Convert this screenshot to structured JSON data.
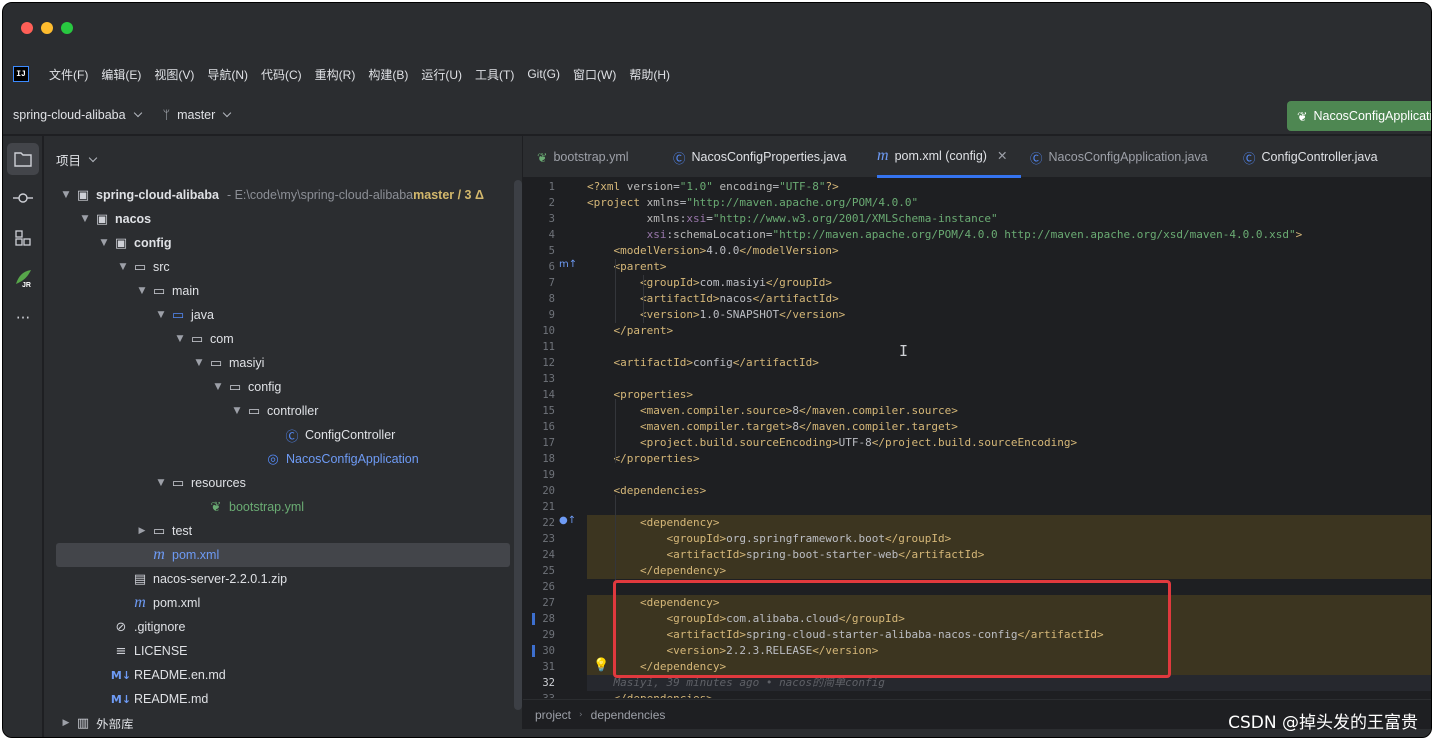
{
  "menu": {
    "logo": "IJ",
    "items": [
      "文件(F)",
      "编辑(E)",
      "视图(V)",
      "导航(N)",
      "代码(C)",
      "重构(R)",
      "构建(B)",
      "运行(U)",
      "工具(T)",
      "Git(G)",
      "窗口(W)",
      "帮助(H)"
    ]
  },
  "toolbar": {
    "project": "spring-cloud-alibaba",
    "branch": "master",
    "run_config": "NacosConfigApplication"
  },
  "project_panel": {
    "title": "项目",
    "root_path": "- E:\\code\\my\\spring-cloud-alibaba",
    "root_vcs": "master / 3 Δ",
    "tree": [
      {
        "label": "spring-cloud-alibaba",
        "depth": 0,
        "arrow": "v",
        "icon": "module-folder-icon",
        "style": "bold"
      },
      {
        "label": "nacos",
        "depth": 1,
        "arrow": "v",
        "icon": "module-folder-icon",
        "style": "bold"
      },
      {
        "label": "config",
        "depth": 2,
        "arrow": "v",
        "icon": "module-folder-icon",
        "style": "bold"
      },
      {
        "label": "src",
        "depth": 3,
        "arrow": "v",
        "icon": "folder-icon",
        "style": ""
      },
      {
        "label": "main",
        "depth": 4,
        "arrow": "v",
        "icon": "folder-icon",
        "style": ""
      },
      {
        "label": "java",
        "depth": 5,
        "arrow": "v",
        "icon": "source-folder-icon",
        "style": ""
      },
      {
        "label": "com",
        "depth": 6,
        "arrow": "v",
        "icon": "package-icon",
        "style": ""
      },
      {
        "label": "masiyi",
        "depth": 7,
        "arrow": "v",
        "icon": "package-icon",
        "style": ""
      },
      {
        "label": "config",
        "depth": 8,
        "arrow": "v",
        "icon": "package-icon",
        "style": ""
      },
      {
        "label": "controller",
        "depth": 9,
        "arrow": "v",
        "icon": "package-icon",
        "style": ""
      },
      {
        "label": "ConfigController",
        "depth": 11,
        "arrow": "",
        "icon": "java-class-icon",
        "style": ""
      },
      {
        "label": "NacosConfigApplication",
        "depth": 10,
        "arrow": "",
        "icon": "spring-app-icon",
        "style": "blue"
      },
      {
        "label": "resources",
        "depth": 5,
        "arrow": "v",
        "icon": "resources-folder-icon",
        "style": ""
      },
      {
        "label": "bootstrap.yml",
        "depth": 7,
        "arrow": "",
        "icon": "yaml-file-icon",
        "style": "green"
      },
      {
        "label": "test",
        "depth": 4,
        "arrow": ">",
        "icon": "folder-icon",
        "style": ""
      },
      {
        "label": "pom.xml",
        "depth": 4,
        "arrow": "",
        "icon": "maven-icon",
        "style": "blue"
      },
      {
        "label": "nacos-server-2.2.0.1.zip",
        "depth": 3,
        "arrow": "",
        "icon": "archive-icon",
        "style": ""
      },
      {
        "label": "pom.xml",
        "depth": 3,
        "arrow": "",
        "icon": "maven-icon",
        "style": ""
      },
      {
        "label": ".gitignore",
        "depth": 2,
        "arrow": "",
        "icon": "gitignore-icon",
        "style": ""
      },
      {
        "label": "LICENSE",
        "depth": 2,
        "arrow": "",
        "icon": "text-file-icon",
        "style": ""
      },
      {
        "label": "README.en.md",
        "depth": 2,
        "arrow": "",
        "icon": "markdown-icon",
        "style": ""
      },
      {
        "label": "README.md",
        "depth": 2,
        "arrow": "",
        "icon": "markdown-icon",
        "style": ""
      },
      {
        "label": "外部库",
        "depth": 0,
        "arrow": ">",
        "icon": "library-icon",
        "style": ""
      }
    ]
  },
  "tabs": [
    {
      "label": "bootstrap.yml",
      "icon": "yaml-file-icon",
      "state": "muted"
    },
    {
      "label": "NacosConfigProperties.java",
      "icon": "java-class-icon",
      "state": "normal"
    },
    {
      "label": "pom.xml (config)",
      "icon": "maven-icon",
      "state": "active",
      "close": "✕"
    },
    {
      "label": "NacosConfigApplication.java",
      "icon": "java-class-icon",
      "state": "muted"
    },
    {
      "label": "ConfigController.java",
      "icon": "java-class-icon",
      "state": "normal"
    }
  ],
  "editor": {
    "lines": [
      {
        "n": "1",
        "html": "<span class='t'>&lt;?xml </span><span class='at'>version</span>=<span class='sv'>\"1.0\"</span> <span class='at'>encoding</span>=<span class='sv'>\"UTF-8\"</span><span class='t'>?&gt;</span>"
      },
      {
        "n": "2",
        "html": "<span class='t'>&lt;project </span><span class='at'>xmlns</span>=<span class='sv'>\"http://maven.apache.org/POM/4.0.0\"</span>"
      },
      {
        "n": "3",
        "html": "         <span class='at'>xmlns</span>:<span class='ns'>xsi</span>=<span class='sv'>\"http://www.w3.org/2001/XMLSchema-instance\"</span>"
      },
      {
        "n": "4",
        "html": "         <span class='ns'>xsi</span>:<span class='at'>schemaLocation</span>=<span class='sv'>\"http://maven.apache.org/POM/4.0.0 http://maven.apache.org/xsd/maven-4.0.0.xsd\"</span><span class='t'>&gt;</span>"
      },
      {
        "n": "5",
        "html": "    <span class='t'>&lt;modelVersion&gt;</span>4.0.0<span class='t'>&lt;/modelVersion&gt;</span>"
      },
      {
        "n": "6",
        "html": "    <span class='t'>&lt;parent&gt;</span>"
      },
      {
        "n": "7",
        "html": "        <span class='t'>&lt;groupId&gt;</span>com.masiyi<span class='t'>&lt;/groupId&gt;</span>"
      },
      {
        "n": "8",
        "html": "        <span class='t'>&lt;artifactId&gt;</span>nacos<span class='t'>&lt;/artifactId&gt;</span>"
      },
      {
        "n": "9",
        "html": "        <span class='t'>&lt;version&gt;</span>1.0-SNAPSHOT<span class='t'>&lt;/version&gt;</span>"
      },
      {
        "n": "10",
        "html": "    <span class='t'>&lt;/parent&gt;</span>"
      },
      {
        "n": "11",
        "html": ""
      },
      {
        "n": "12",
        "html": "    <span class='t'>&lt;artifactId&gt;</span>config<span class='t'>&lt;/artifactId&gt;</span>"
      },
      {
        "n": "13",
        "html": ""
      },
      {
        "n": "14",
        "html": "    <span class='t'>&lt;properties&gt;</span>"
      },
      {
        "n": "15",
        "html": "        <span class='t'>&lt;maven.compiler.source&gt;</span>8<span class='t'>&lt;/maven.compiler.source&gt;</span>"
      },
      {
        "n": "16",
        "html": "        <span class='t'>&lt;maven.compiler.target&gt;</span>8<span class='t'>&lt;/maven.compiler.target&gt;</span>"
      },
      {
        "n": "17",
        "html": "        <span class='t'>&lt;project.build.sourceEncoding&gt;</span>UTF-8<span class='t'>&lt;/project.build.sourceEncoding&gt;</span>"
      },
      {
        "n": "18",
        "html": "    <span class='t'>&lt;/properties&gt;</span>"
      },
      {
        "n": "19",
        "html": ""
      },
      {
        "n": "20",
        "html": "    <span class='t'>&lt;dependencies&gt;</span>"
      },
      {
        "n": "21",
        "html": ""
      },
      {
        "n": "22",
        "html": "        <span class='t'>&lt;dependency&gt;</span>"
      },
      {
        "n": "23",
        "html": "            <span class='t'>&lt;groupId&gt;</span>org.springframework.boot<span class='t'>&lt;/groupId&gt;</span>"
      },
      {
        "n": "24",
        "html": "            <span class='t'>&lt;artifactId&gt;</span>spring-boot-starter-web<span class='t'>&lt;/artifactId&gt;</span>"
      },
      {
        "n": "25",
        "html": "        <span class='t'>&lt;/dependency&gt;</span>"
      },
      {
        "n": "26",
        "html": ""
      },
      {
        "n": "27",
        "html": "        <span class='t'>&lt;dependency&gt;</span>"
      },
      {
        "n": "28",
        "html": "            <span class='t'>&lt;groupId&gt;</span>com.alibaba.cloud<span class='t'>&lt;/groupId&gt;</span>"
      },
      {
        "n": "29",
        "html": "            <span class='t'>&lt;artifactId&gt;</span>spring-cloud-starter-alibaba-nacos-config<span class='t'>&lt;/artifactId&gt;</span>"
      },
      {
        "n": "30",
        "html": "            <span class='t'>&lt;version&gt;</span>2.2.3.RELEASE<span class='t'>&lt;/version&gt;</span>"
      },
      {
        "n": "31",
        "html": "        <span class='t'>&lt;/dependency&gt;</span>"
      },
      {
        "n": "32",
        "html": "    <span class='blame'>Masiyi, 39 minutes ago • nacos的简单config</span>"
      },
      {
        "n": "33",
        "html": "    <span class='t'>&lt;/dependencies&gt;</span>"
      }
    ],
    "current_line": "32"
  },
  "breadcrumb": [
    "project",
    "dependencies"
  ],
  "watermark": "CSDN @掉头发的王富贵",
  "colors": {
    "window_bg": "#1e1f22",
    "panel_bg": "#2b2d30",
    "accent": "#3574f0",
    "run_button": "#4e8752",
    "highlight_box": "#e0393e"
  }
}
